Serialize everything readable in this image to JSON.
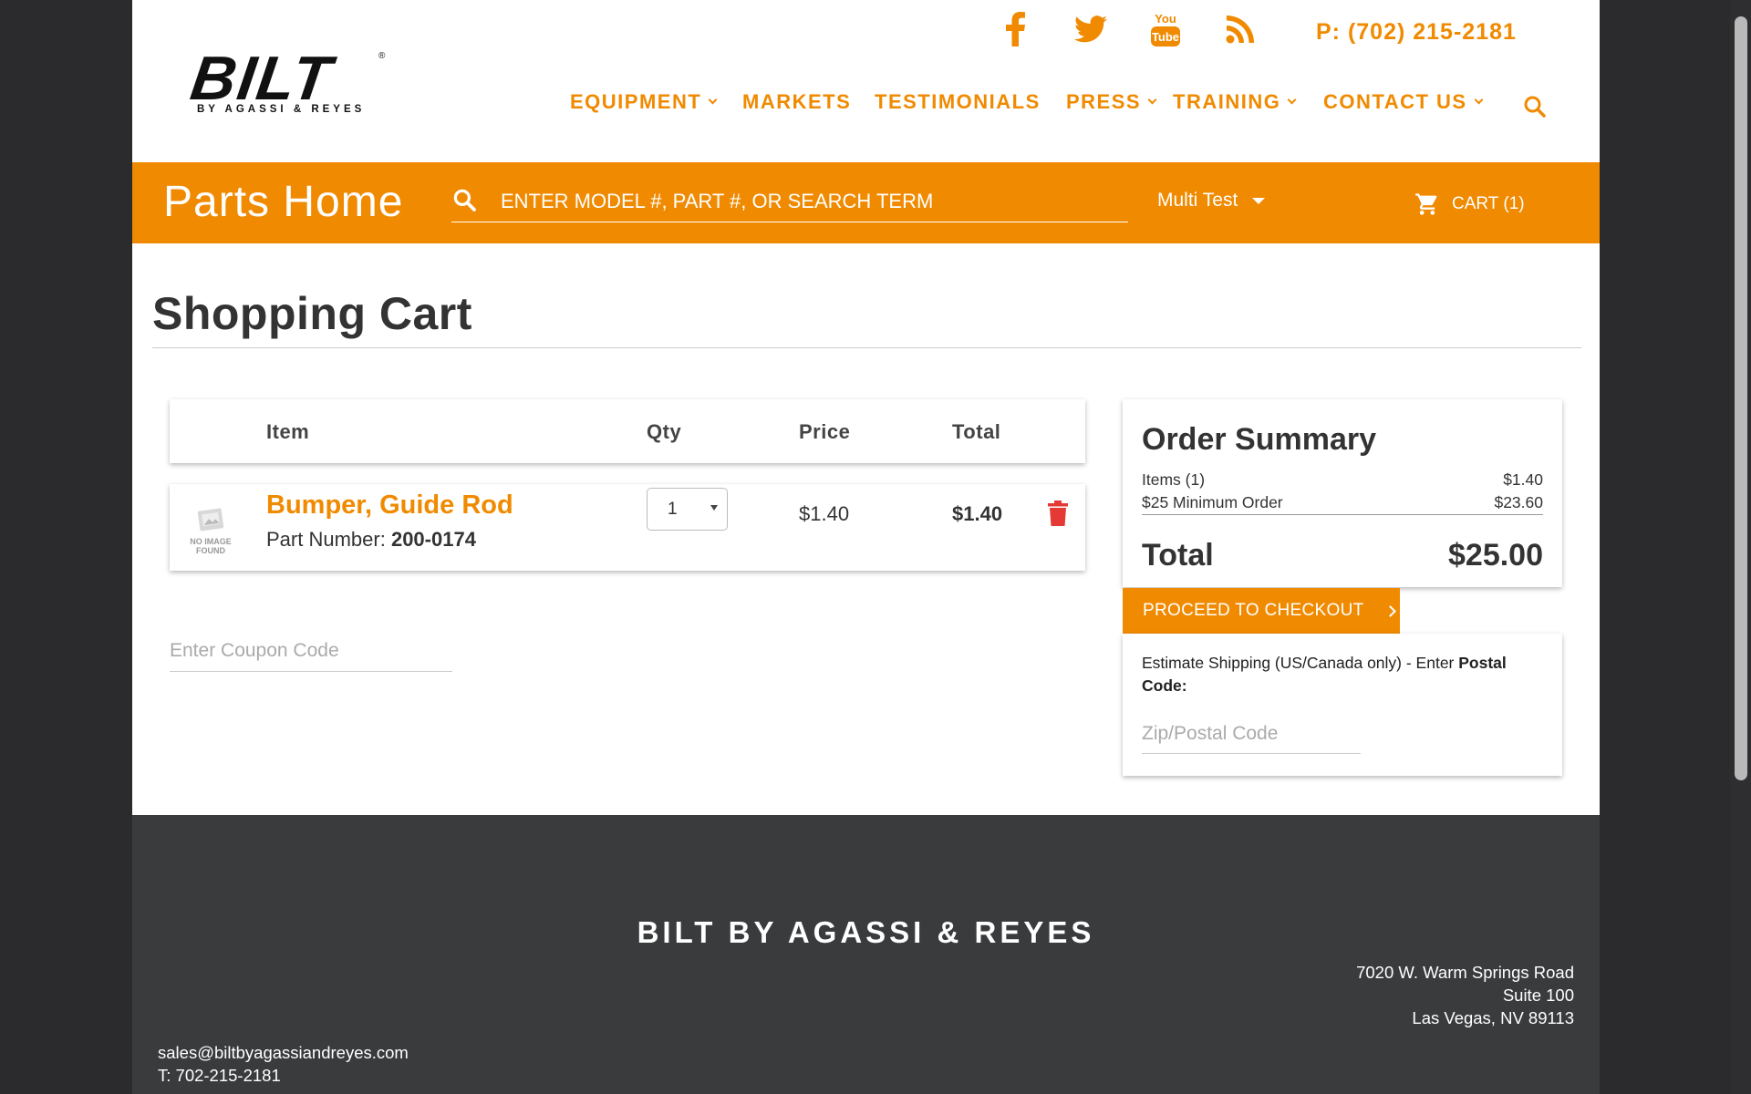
{
  "header": {
    "logo_word": "BILT",
    "logo_reg": "®",
    "logo_sub": "BY AGASSI & REYES",
    "phone": "P: (702) 215-2181",
    "social_icons": [
      "facebook-icon",
      "twitter-icon",
      "youtube-icon",
      "rss-icon"
    ],
    "nav": [
      {
        "label": "EQUIPMENT",
        "dropdown": true
      },
      {
        "label": "MARKETS",
        "dropdown": false
      },
      {
        "label": "TESTIMONIALS",
        "dropdown": false
      },
      {
        "label": "PRESS",
        "dropdown": true
      },
      {
        "label": "TRAINING",
        "dropdown": true
      },
      {
        "label": "CONTACT US",
        "dropdown": true
      }
    ]
  },
  "parts_bar": {
    "title": "Parts Home",
    "search_placeholder": "ENTER MODEL #, PART #, OR SEARCH TERM",
    "account": "Multi Test",
    "cart": "CART (1)"
  },
  "cart": {
    "title": "Shopping Cart",
    "columns": {
      "item": "Item",
      "qty": "Qty",
      "price": "Price",
      "total": "Total"
    },
    "items": [
      {
        "image_text": "NO IMAGE FOUND",
        "name": "Bumper, Guide Rod",
        "part_label": "Part Number:",
        "part_number": "200-0174",
        "qty": "1",
        "price": "$1.40",
        "total": "$1.40"
      }
    ],
    "coupon_placeholder": "Enter Coupon Code"
  },
  "summary": {
    "title": "Order Summary",
    "lines": [
      {
        "label": "Items (1)",
        "value": "$1.40"
      },
      {
        "label": "$25 Minimum Order",
        "value": "$23.60"
      }
    ],
    "total_label": "Total",
    "total_value": "$25.00",
    "checkout_label": "PROCEED TO CHECKOUT",
    "shipping_text": "Estimate Shipping (US/Canada only) - Enter ",
    "shipping_bold": "Postal Code:",
    "zip_placeholder": "Zip/Postal Code"
  },
  "footer": {
    "brand": "BILT BY AGASSI & REYES",
    "address": [
      "7020 W. Warm Springs Road",
      "Suite 100",
      "Las Vegas, NV 89113"
    ],
    "email": "sales@biltbyagassiandreyes.com",
    "phone": "T: 702-215-2181"
  },
  "colors": {
    "accent": "#f08a00",
    "footer": "#3a3b3d",
    "delete": "#e53935"
  }
}
